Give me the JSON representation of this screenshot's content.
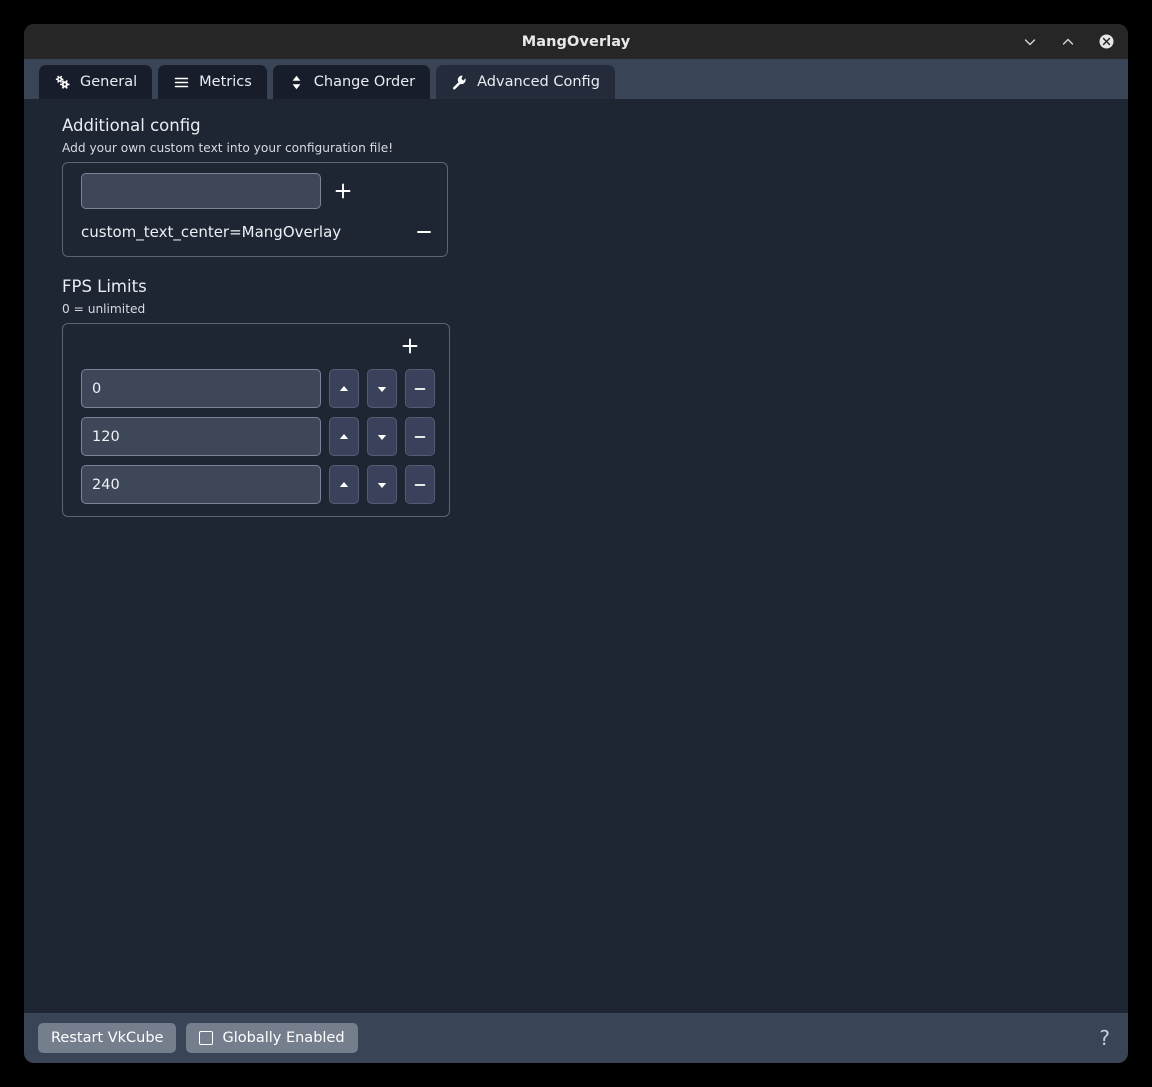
{
  "window": {
    "title": "MangOverlay",
    "controls": [
      {
        "name": "minimize",
        "icon": "chevron-down-icon"
      },
      {
        "name": "maximize",
        "icon": "chevron-up-icon"
      },
      {
        "name": "close",
        "icon": "close-circle-icon"
      }
    ]
  },
  "tabs": [
    {
      "label": "General",
      "icon": "cogs-icon",
      "active": false
    },
    {
      "label": "Metrics",
      "icon": "hamburger-icon",
      "active": false
    },
    {
      "label": "Change Order",
      "icon": "sort-updown-icon",
      "active": false
    },
    {
      "label": "Advanced Config",
      "icon": "wrench-icon",
      "active": true
    }
  ],
  "additional_config": {
    "title": "Additional config",
    "subtitle": "Add your own custom text into your configuration file!",
    "input_value": "",
    "input_placeholder": "",
    "add_label": "+",
    "entries": [
      {
        "text": "custom_text_center=MangOverlay",
        "remove_label": "−"
      }
    ]
  },
  "fps_limits": {
    "title": "FPS Limits",
    "subtitle": "0 = unlimited",
    "add_label": "+",
    "rows": [
      {
        "value": "0",
        "up_label": "▲",
        "down_label": "▼",
        "remove_label": "−"
      },
      {
        "value": "120",
        "up_label": "▲",
        "down_label": "▼",
        "remove_label": "−"
      },
      {
        "value": "240",
        "up_label": "▲",
        "down_label": "▼",
        "remove_label": "−"
      }
    ]
  },
  "bottom_bar": {
    "restart_label": "Restart VkCube",
    "globally_enabled_label": "Globally Enabled",
    "globally_enabled_checked": false,
    "help_label": "?"
  },
  "colors": {
    "outer_background": "#000000",
    "titlebar": "#262626",
    "tabstrip": "#3a4457",
    "tab_inactive": "#171d2a",
    "tab_active": "#242c3b",
    "content_background": "#1e2633",
    "input_background": "#3d4757",
    "groupbox_border": "#5a6478",
    "bottombar": "#3a4457",
    "button": "#757e8d",
    "text": "#e9ecf2"
  }
}
